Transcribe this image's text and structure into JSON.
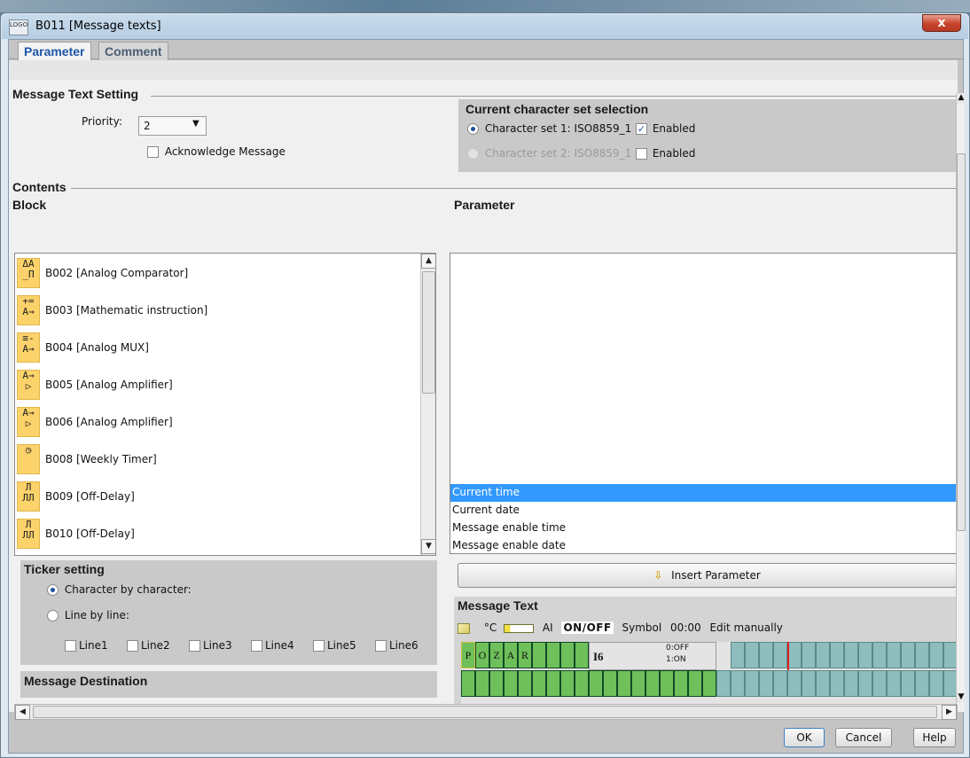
{
  "window": {
    "title": "B011 [Message texts]",
    "app_icon_text": "LOGO",
    "close_label": "x"
  },
  "tabs": [
    {
      "label": "Parameter"
    },
    {
      "label": "Comment"
    }
  ],
  "message_text_setting": {
    "header": "Message Text Setting",
    "priority_label": "Priority:",
    "priority_value": "2",
    "acknowledge_label": "Acknowledge Message"
  },
  "charset": {
    "header": "Current character set selection",
    "set1_label": "Character set 1: ISO8859_1",
    "set1_enabled_label": "Enabled",
    "set2_label": "Character set 2: ISO8859_1",
    "set2_enabled_label": "Enabled"
  },
  "contents": {
    "header": "Contents",
    "block_header": "Block",
    "parameter_header": "Parameter",
    "blocks": [
      {
        "label": "B002 [Analog Comparator]",
        "icon_text": "ΔA\n_Π"
      },
      {
        "label": "B003 [Mathematic instruction]",
        "icon_text": "+=\nA→"
      },
      {
        "label": "B004 [Analog MUX]",
        "icon_text": "≡-\nA→"
      },
      {
        "label": "B005 [Analog Amplifier]",
        "icon_text": "A→\n▷"
      },
      {
        "label": "B006 [Analog Amplifier]",
        "icon_text": "A→\n▷"
      },
      {
        "label": "B008 [Weekly Timer]",
        "icon_text": "◷"
      },
      {
        "label": "B009 [Off-Delay]",
        "icon_text": "Л\nЛЛ"
      },
      {
        "label": "B010 [Off-Delay]",
        "icon_text": "Л\nЛЛ"
      }
    ],
    "parameters": [
      "Current time",
      "Current date",
      "Message enable time",
      "Message enable date"
    ]
  },
  "ticker": {
    "header": "Ticker setting",
    "char_by_char": "Character by character:",
    "line_by_line": "Line by line:",
    "lines": [
      "Line1",
      "Line2",
      "Line3",
      "Line4",
      "Line5",
      "Line6"
    ]
  },
  "destination": {
    "header": "Message Destination"
  },
  "insert_parameter": "Insert Parameter",
  "message_text": {
    "header": "Message Text",
    "toolbar": {
      "celsius": "°C",
      "ai": "AI",
      "onoff": "ON/OFF",
      "symbol": "Symbol",
      "time": "00:00",
      "edit": "Edit manually"
    },
    "row1_chars": [
      "P",
      "O",
      "Z",
      "A",
      "R"
    ],
    "input_ref": "I6",
    "state_off": "0:OFF",
    "state_on": "1:ON"
  },
  "footer": {
    "ok": "OK",
    "cancel": "Cancel",
    "help": "Help"
  },
  "colors": {
    "selection": "#3399ff",
    "grid_green": "#6fbf5a",
    "grid_teal": "#8fbdbd",
    "cursor_red": "#e02020"
  }
}
